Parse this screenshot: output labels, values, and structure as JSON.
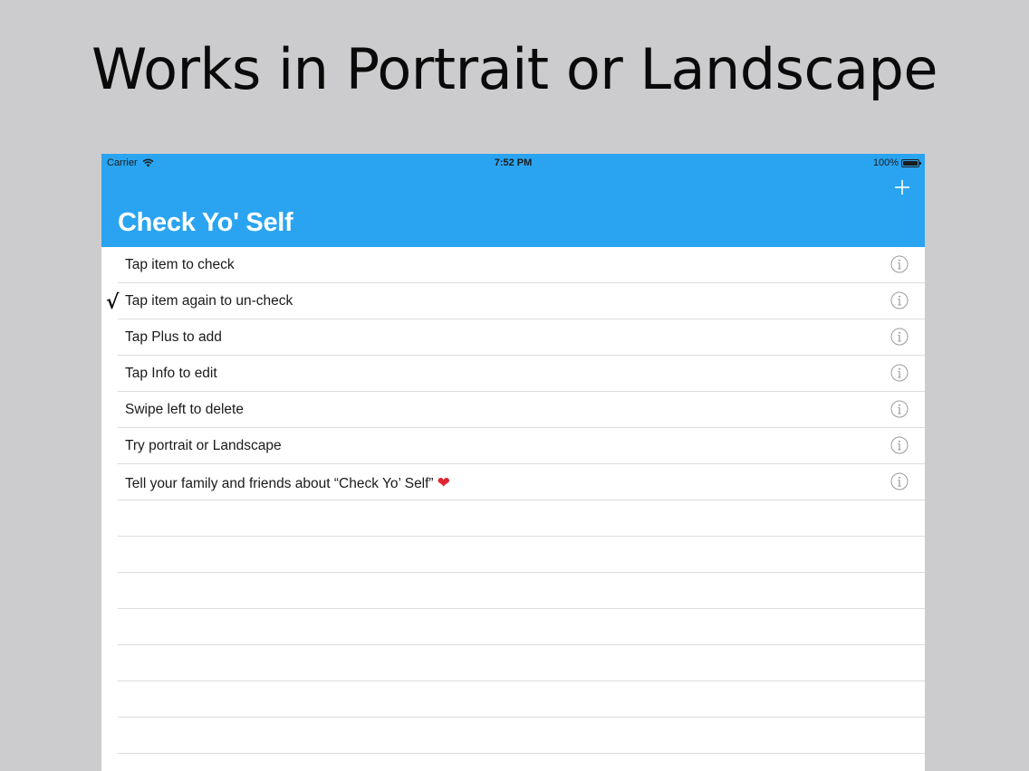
{
  "promo": {
    "title": "Works in Portrait or Landscape"
  },
  "status_bar": {
    "carrier": "Carrier",
    "time": "7:52 PM",
    "battery": "100%"
  },
  "nav": {
    "title": "Check Yo' Self",
    "add_icon": "plus-icon",
    "accent_color": "#2aa4f0"
  },
  "items": [
    {
      "label": "Tap item to check",
      "checked": false
    },
    {
      "label": "Tap item again to un-check",
      "checked": true,
      "check_mark": "√"
    },
    {
      "label": "Tap Plus to add",
      "checked": false
    },
    {
      "label": "Tap Info to edit",
      "checked": false
    },
    {
      "label": "Swipe left to delete",
      "checked": false
    },
    {
      "label": "Try portrait or Landscape",
      "checked": false
    },
    {
      "label": "Tell your family and friends about “Check Yo’ Self”",
      "checked": false,
      "emoji": "❤"
    }
  ],
  "empty_rows": 8
}
